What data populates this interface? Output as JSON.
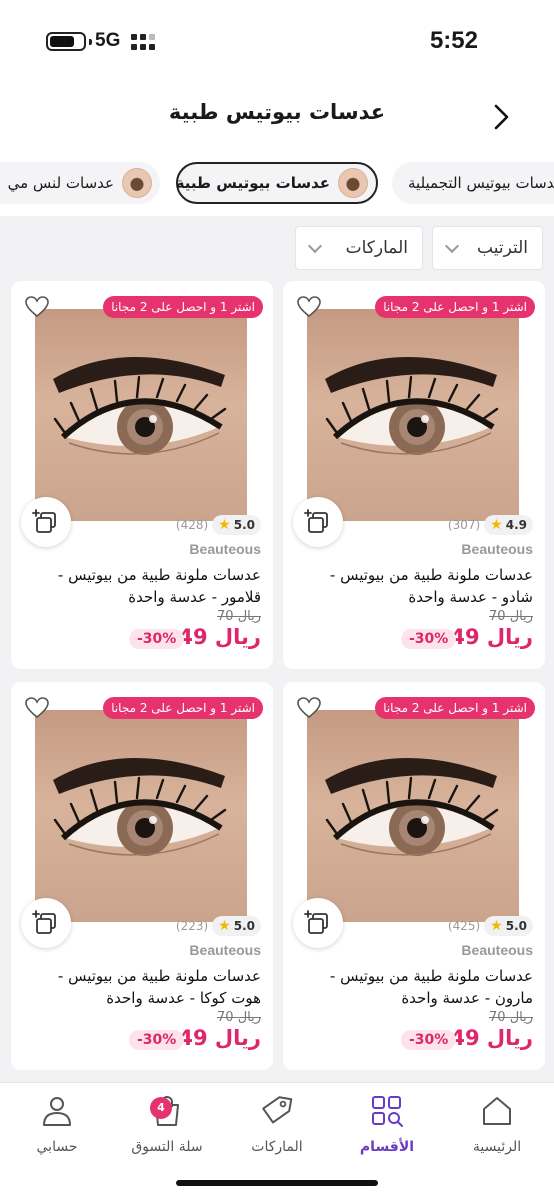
{
  "status_bar": {
    "time": "5:52",
    "network": "5G"
  },
  "header": {
    "title": "عدسات بيوتيس طبية"
  },
  "categories": [
    {
      "label": "ـدسات بيوتيس التجميلية",
      "active": false
    },
    {
      "label": "عدسات بيوتيس طبية",
      "active": true
    },
    {
      "label": "عدسات لنس مي",
      "active": false
    }
  ],
  "filters": {
    "sort_label": "الترتيب",
    "brands_label": "الماركات"
  },
  "products": [
    {
      "promo": "اشتر 1 و احصل على 2 مجانا",
      "rating": "4.9",
      "reviews": "(307)",
      "brand": "Beauteous",
      "name": "عدسات ملونة طبية من بيوتيس - شادو - عدسة واحدة",
      "old_price": "70 ريال",
      "price": "49 ريال",
      "discount": "-30%"
    },
    {
      "promo": "اشتر 1 و احصل على 2 مجانا",
      "rating": "5.0",
      "reviews": "(428)",
      "brand": "Beauteous",
      "name": "عدسات ملونة طبية من بيوتيس - قلامور - عدسة واحدة",
      "old_price": "70 ريال",
      "price": "49 ريال",
      "discount": "-30%"
    },
    {
      "promo": "اشتر 1 و احصل على 2 مجانا",
      "rating": "5.0",
      "reviews": "(425)",
      "brand": "Beauteous",
      "name": "عدسات ملونة طبية من بيوتيس - مارون  - عدسة واحدة",
      "old_price": "70 ريال",
      "price": "49 ريال",
      "discount": "-30%"
    },
    {
      "promo": "اشتر 1 و احصل على 2 مجانا",
      "rating": "5.0",
      "reviews": "(223)",
      "brand": "Beauteous",
      "name": "عدسات ملونة طبية من بيوتيس - هوت كوكا - عدسة واحدة",
      "old_price": "70 ريال",
      "price": "49 ريال",
      "discount": "-30%"
    }
  ],
  "bottom_nav": {
    "home": "الرئيسية",
    "categories": "الأقسام",
    "brands": "الماركات",
    "cart": "سلة التسوق",
    "cart_count": "4",
    "account": "حسابي"
  },
  "colors": {
    "accent": "#e6336d",
    "active_nav": "#6a3cc4"
  }
}
